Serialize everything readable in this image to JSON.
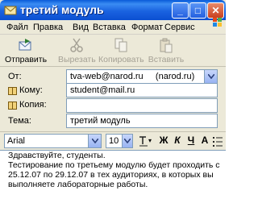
{
  "window": {
    "title": "третий модуль"
  },
  "title_buttons": {
    "minimize": "_",
    "maximize": "□",
    "close": "✕"
  },
  "menu": [
    "Файл",
    "Правка",
    "Вид",
    "Вставка",
    "Формат",
    "Сервис"
  ],
  "toolbar": [
    {
      "label": "Отправить",
      "icon": "send-icon",
      "enabled": true
    },
    {
      "label": "Вырезать",
      "icon": "scissors-icon",
      "enabled": false
    },
    {
      "label": "Копировать",
      "icon": "copy-icon",
      "enabled": false
    },
    {
      "label": "Вставить",
      "icon": "paste-icon",
      "enabled": false
    }
  ],
  "fields": {
    "from_label": "От:",
    "from_value": "tva-web@narod.ru     (narod.ru)",
    "to_label": "Кому:",
    "to_value": "student@mail.ru",
    "cc_label": "Копия:",
    "cc_value": "",
    "subject_label": "Тема:",
    "subject_value": "третий модуль"
  },
  "format_bar": {
    "font": "Arial",
    "size": "10",
    "bold": "Ж",
    "italic": "К",
    "underline": "Ч",
    "color": "А"
  },
  "message_lines": [
    "Здравствуйте, студенты.",
    "Тестирование по третьему модулю  будет проходить с",
    "25.12.07 по 29.12.07 в тех аудиториях, в которых вы",
    "выполняете лабораторные работы."
  ],
  "colors": {
    "titlebar": "#0b4fd1",
    "chrome": "#ece9d8",
    "field_border": "#7f9db9"
  }
}
